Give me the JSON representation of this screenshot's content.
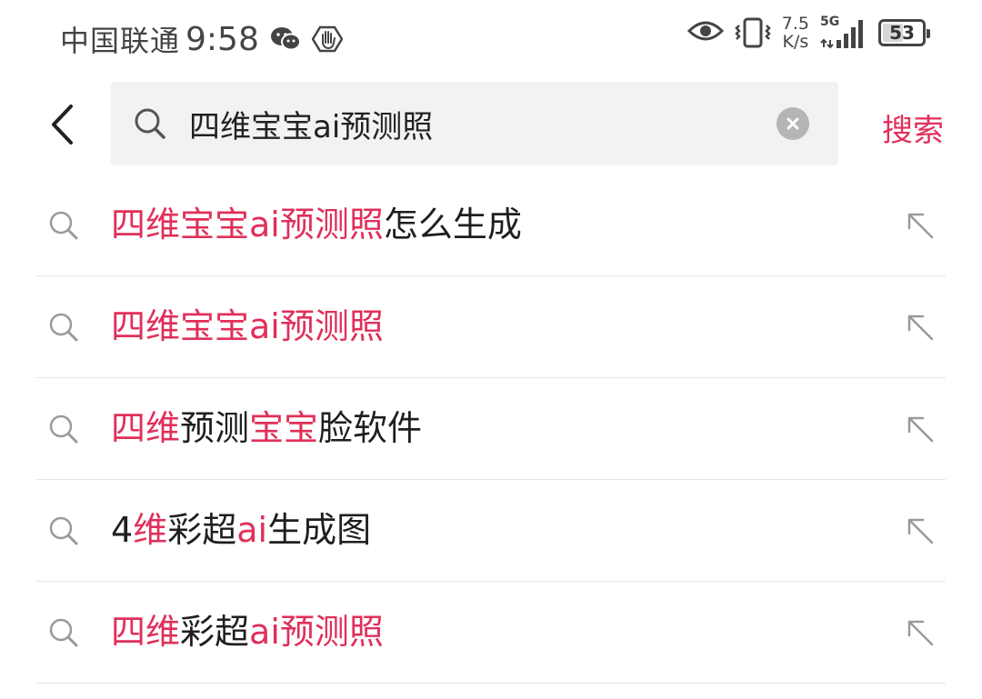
{
  "status_bar": {
    "carrier": "中国联通",
    "time": "9:58",
    "net_speed_value": "7.5",
    "net_speed_unit": "K/s",
    "network_type": "5G",
    "battery_level": "53",
    "icons": [
      "wechat-icon",
      "hand-icon",
      "eye-icon",
      "vibrate-icon",
      "signal-icon",
      "battery-icon"
    ]
  },
  "search": {
    "query": "四维宝宝ai预测照",
    "submit_label": "搜索",
    "accent_color": "#e0305a"
  },
  "suggestions": [
    {
      "segments": [
        {
          "text": "四维宝宝ai预测照",
          "highlight": true
        },
        {
          "text": "怎么生成",
          "highlight": false
        }
      ]
    },
    {
      "segments": [
        {
          "text": "四维宝宝ai预测照",
          "highlight": true
        }
      ]
    },
    {
      "segments": [
        {
          "text": "四维",
          "highlight": true
        },
        {
          "text": "预测",
          "highlight": false
        },
        {
          "text": "宝宝",
          "highlight": true
        },
        {
          "text": "脸软件",
          "highlight": false
        }
      ]
    },
    {
      "segments": [
        {
          "text": "4",
          "highlight": false
        },
        {
          "text": "维",
          "highlight": true
        },
        {
          "text": "彩超",
          "highlight": false
        },
        {
          "text": "ai",
          "highlight": true
        },
        {
          "text": "生成图",
          "highlight": false
        }
      ]
    },
    {
      "segments": [
        {
          "text": "四维",
          "highlight": true
        },
        {
          "text": "彩超",
          "highlight": false
        },
        {
          "text": "ai预测照",
          "highlight": true
        }
      ]
    }
  ]
}
